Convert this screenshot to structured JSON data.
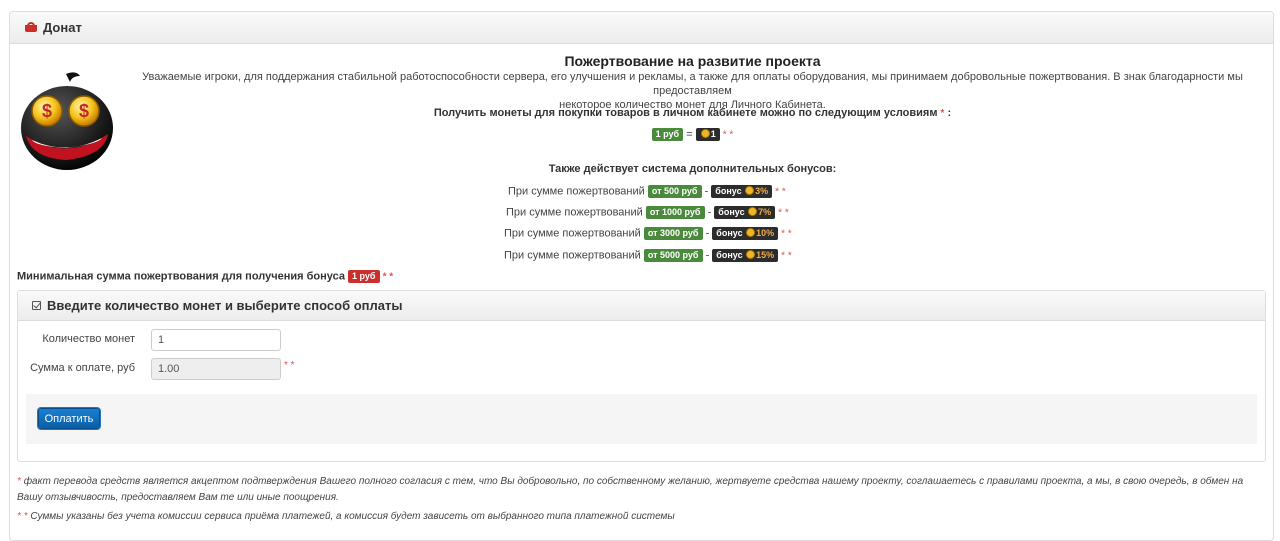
{
  "header": {
    "title": "Донат"
  },
  "donation": {
    "title": "Пожертвование на развитие проекта",
    "intro_line1": "Уважаемые игроки, для поддержания стабильной работоспособности сервера, его улучшения и рекламы, а также для оплаты оборудования, мы принимаем добровольные пожертвования. В знак благодарности мы предоставляем",
    "intro_line2": "некоторое количество монет для Личного Кабинета.",
    "conditions": "Получить монеты для покупки товаров в личном кабинете можно по следующим условиям",
    "rate": {
      "rub": "1 руб",
      "eq": "=",
      "coins": "1"
    },
    "bonus_title": "Также действует система дополнительных бонусов:",
    "bonus_rows": [
      {
        "text": "При сумме пожертвований",
        "from": "от 500 руб",
        "bonus": "бонус",
        "pct": "3%"
      },
      {
        "text": "При сумме пожертвований",
        "from": "от 1000 руб",
        "bonus": "бонус",
        "pct": "7%"
      },
      {
        "text": "При сумме пожертвований",
        "from": "от 3000 руб",
        "bonus": "бонус",
        "pct": "10%"
      },
      {
        "text": "При сумме пожертвований",
        "from": "от 5000 руб",
        "bonus": "бонус",
        "pct": "15%"
      }
    ],
    "dash": "-",
    "min_text": "Минимальная сумма пожертвования для получения бонуса",
    "min_value": "1 руб",
    "star1": "*",
    "star2": "* *"
  },
  "form": {
    "title": "Введите количество монет и выберите способ оплаты",
    "coins_label": "Количество монет",
    "coins_value": "1",
    "sum_label": "Сумма к оплате, руб",
    "sum_value": "1.00",
    "pay_button": "Оплатить"
  },
  "footnotes": {
    "note1_line1": "факт перевода средств является акцептом подтверждения Вашего полного согласия с тем, что Вы добровольно, по собственному желанию, жертвуете средства нашему проекту, соглашаетесь с правилами проекта, а мы, в свою очередь, в обмен на",
    "note1_line2": "Вашу отзывчивость, предоставляем Вам те или иные поощрения.",
    "note2": "Суммы указаны без учета комиссии сервиса приёма платежей, а комиссия будет зависеть от выбранного типа платежной системы"
  },
  "colors": {
    "green": "#4a8a3c",
    "dark": "#2c2c2c",
    "red": "#c9302c",
    "button": "#0b6fc2"
  },
  "icons": [
    "basket-icon",
    "dollar-smiley-icon",
    "coin-icon",
    "checkbox-edit-icon"
  ]
}
